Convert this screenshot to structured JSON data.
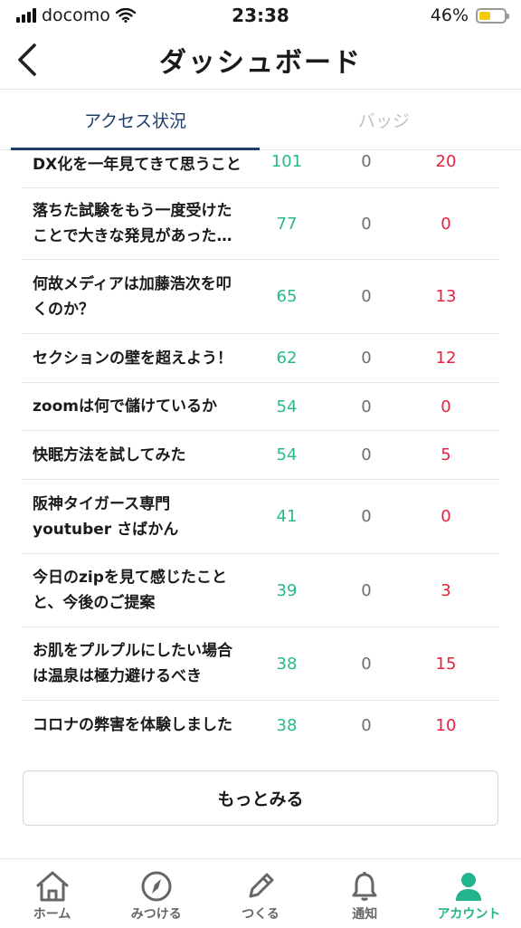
{
  "status_bar": {
    "carrier": "docomo",
    "time": "23:38",
    "battery": "46%",
    "battery_level": 0.46
  },
  "header": {
    "title": "ダッシュボード"
  },
  "tabs": [
    {
      "label": "アクセス状況",
      "active": true
    },
    {
      "label": "バッジ",
      "active": false
    }
  ],
  "rows": [
    {
      "title": "DX化を一年見てきて思うこと",
      "views": "101",
      "mid": "0",
      "stars": "20"
    },
    {
      "title": "落ちた試験をもう一度受けたことで大きな発見があった…",
      "views": "77",
      "mid": "0",
      "stars": "0"
    },
    {
      "title": "何故メディアは加藤浩次を叩くのか？",
      "views": "65",
      "mid": "0",
      "stars": "13"
    },
    {
      "title": "セクションの壁を超えよう！",
      "views": "62",
      "mid": "0",
      "stars": "12"
    },
    {
      "title": "zoomは何で儲けているか",
      "views": "54",
      "mid": "0",
      "stars": "0"
    },
    {
      "title": "快眠方法を試してみた",
      "views": "54",
      "mid": "0",
      "stars": "5"
    },
    {
      "title": "阪神タイガース専門youtuber さばかん",
      "views": "41",
      "mid": "0",
      "stars": "0"
    },
    {
      "title": "今日のzipを見て感じたことと、今後のご提案",
      "views": "39",
      "mid": "0",
      "stars": "3"
    },
    {
      "title": "お肌をプルプルにしたい場合は温泉は極力避けるべき",
      "views": "38",
      "mid": "0",
      "stars": "15"
    },
    {
      "title": "コロナの弊害を体験しました",
      "views": "38",
      "mid": "0",
      "stars": "10"
    }
  ],
  "more_button": "もっとみる",
  "tabbar": [
    {
      "label": "ホーム",
      "icon": "home-icon"
    },
    {
      "label": "みつける",
      "icon": "compass-icon"
    },
    {
      "label": "つくる",
      "icon": "pencil-icon"
    },
    {
      "label": "通知",
      "icon": "bell-icon"
    },
    {
      "label": "アカウント",
      "icon": "person-icon",
      "active": true
    }
  ],
  "colors": {
    "accent_green": "#22b48c",
    "tab_navy": "#1f3d6a",
    "red": "#e8203f",
    "battery_yellow": "#f6c90e"
  }
}
